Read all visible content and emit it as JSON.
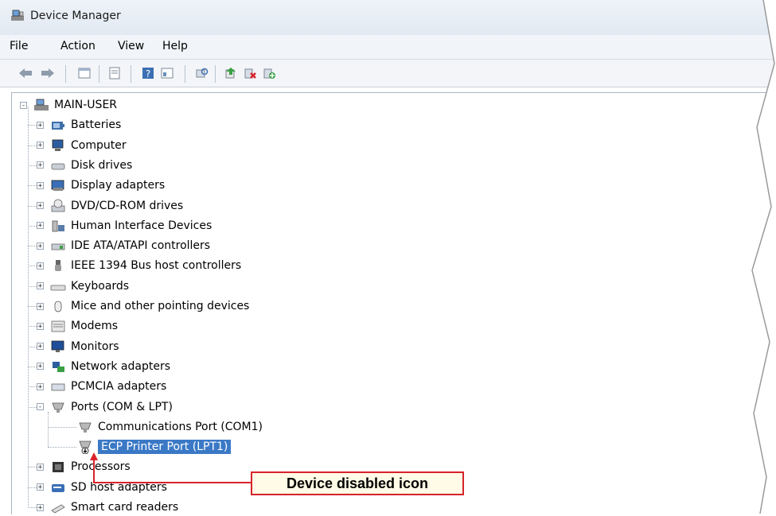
{
  "window": {
    "title": "Device Manager"
  },
  "menu": [
    "File",
    "Action",
    "View",
    "Help"
  ],
  "toolbar": {
    "buttons": [
      "back-icon",
      "forward-icon",
      "properties-icon",
      "show-hide-icon",
      "help-icon",
      "view-icon",
      "scan-icon",
      "update-driver-icon",
      "uninstall-icon",
      "enable-icon"
    ]
  },
  "tree": {
    "root": "MAIN-USER",
    "items": [
      {
        "label": "Batteries",
        "icon": "battery-icon"
      },
      {
        "label": "Computer",
        "icon": "computer-icon"
      },
      {
        "label": "Disk drives",
        "icon": "disk-icon"
      },
      {
        "label": "Display adapters",
        "icon": "display-icon"
      },
      {
        "label": "DVD/CD-ROM drives",
        "icon": "dvd-icon"
      },
      {
        "label": "Human Interface Devices",
        "icon": "hid-icon"
      },
      {
        "label": "IDE ATA/ATAPI controllers",
        "icon": "ide-icon"
      },
      {
        "label": "IEEE 1394 Bus host controllers",
        "icon": "ieee-icon"
      },
      {
        "label": "Keyboards",
        "icon": "keyboard-icon"
      },
      {
        "label": "Mice and other pointing devices",
        "icon": "mouse-icon"
      },
      {
        "label": "Modems",
        "icon": "modem-icon"
      },
      {
        "label": "Monitors",
        "icon": "monitor-icon"
      },
      {
        "label": "Network adapters",
        "icon": "network-icon"
      },
      {
        "label": "PCMCIA adapters",
        "icon": "pcmcia-icon"
      },
      {
        "label": "Ports (COM & LPT)",
        "icon": "port-icon",
        "expanded": true,
        "children": [
          {
            "label": "Communications Port (COM1)",
            "icon": "port-icon"
          },
          {
            "label": "ECP Printer Port (LPT1)",
            "icon": "port-disabled-icon",
            "selected": true
          }
        ]
      },
      {
        "label": "Processors",
        "icon": "processor-icon"
      },
      {
        "label": "SD host adapters",
        "icon": "sd-icon"
      },
      {
        "label": "Smart card readers",
        "icon": "smartcard-icon"
      }
    ]
  },
  "callout": {
    "text": "Device disabled icon"
  },
  "colors": {
    "selection": "#3b79c6",
    "callout_border": "#d8232a"
  }
}
